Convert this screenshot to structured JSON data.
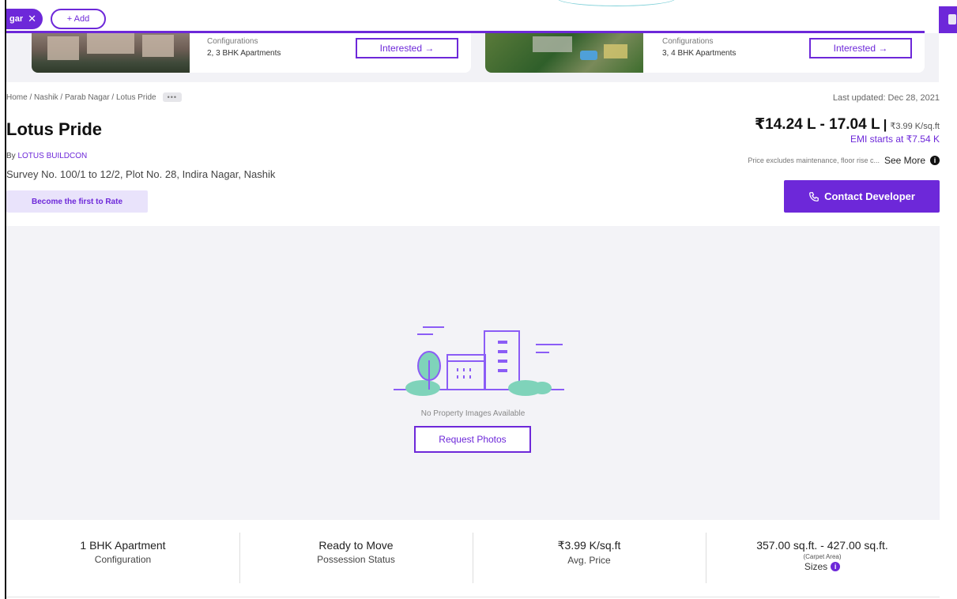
{
  "filter_bar": {
    "active_chip": "gar",
    "add_chip": "+ Add"
  },
  "project_cards": [
    {
      "config_label": "Configurations",
      "config_value": "2, 3 BHK Apartments",
      "cta": "Interested →"
    },
    {
      "config_label": "Configurations",
      "config_value": "3, 4 BHK Apartments",
      "cta": "Interested →"
    }
  ],
  "breadcrumb": [
    "Home",
    "Nashik",
    "Parab Nagar",
    "Lotus Pride"
  ],
  "breadcrumb_more": "•••",
  "last_updated": "Last updated: Dec 28, 2021",
  "project": {
    "title": "Lotus Pride",
    "by_prefix": "By",
    "developer": "LOTUS BUILDCON",
    "address": "Survey No. 100/1 to 12/2, Plot No. 28, Indira Nagar, Nashik",
    "rate_cta": "Become the first to Rate"
  },
  "price": {
    "range": "₹14.24 L - 17.04 L",
    "separator": "|",
    "per_sqft": "₹3.99 K/sq.ft",
    "emi": "EMI starts at ₹7.54 K",
    "note": "Price excludes maintenance, floor rise c...",
    "see_more": "See More",
    "info_glyph": "i"
  },
  "contact_button": "Contact Developer",
  "images": {
    "empty_text": "No Property Images Available",
    "request_button": "Request Photos"
  },
  "stats": [
    {
      "value": "1 BHK Apartment",
      "label": "Configuration"
    },
    {
      "value": "Ready to Move",
      "label": "Possession Status"
    },
    {
      "value": "₹3.99 K/sq.ft",
      "label": "Avg. Price"
    },
    {
      "value": "357.00 sq.ft. - 427.00 sq.ft.",
      "sub": "(Carpet Area)",
      "label": "Sizes",
      "info_glyph": "i"
    }
  ],
  "colors": {
    "accent": "#6d28d9",
    "accent_light": "#e9e3fb",
    "illustration_green": "#7fd3ba"
  }
}
